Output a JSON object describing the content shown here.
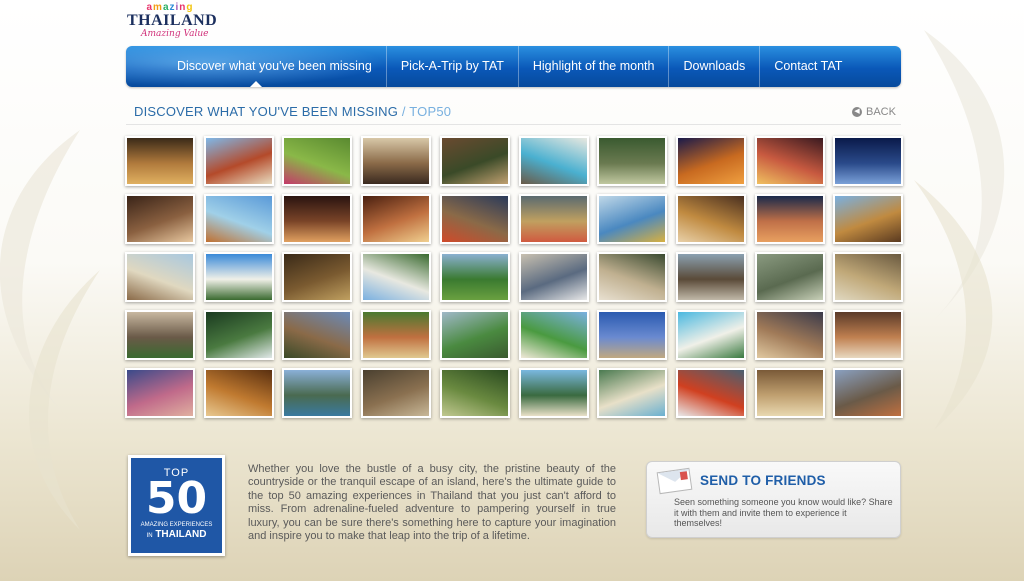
{
  "logo": {
    "word_amazing": "amazing",
    "word_thailand": "THAILAND",
    "tagline": "Amazing Value"
  },
  "nav": {
    "items": [
      {
        "label": "Discover what you've been missing",
        "active": true
      },
      {
        "label": "Pick-A-Trip by TAT",
        "active": false
      },
      {
        "label": "Highlight of the month",
        "active": false
      },
      {
        "label": "Downloads",
        "active": false
      },
      {
        "label": "Contact TAT",
        "active": false
      }
    ]
  },
  "breadcrumb": {
    "main": "DISCOVER WHAT YOU'VE BEEN MISSING",
    "separator": "/",
    "current": "TOP50"
  },
  "back_label": "BACK",
  "gallery": {
    "rows": 5,
    "columns": 10,
    "thumbnails": [
      {
        "subject": "hotel lobby interior",
        "colors": [
          "#3a2a18",
          "#b07a3c",
          "#e0b060"
        ]
      },
      {
        "subject": "thai temple roof",
        "colors": [
          "#7fb8e8",
          "#b44a2a",
          "#e8dcc0"
        ]
      },
      {
        "subject": "tea plantation workers",
        "colors": [
          "#5a8a30",
          "#8ab848",
          "#c43a6a"
        ]
      },
      {
        "subject": "colonial building courtyard",
        "colors": [
          "#d8c8a8",
          "#8a6a48",
          "#3a2a20"
        ]
      },
      {
        "subject": "wooden resort villa",
        "colors": [
          "#6a4a30",
          "#3a4a28",
          "#c0a070"
        ]
      },
      {
        "subject": "pool villa",
        "colors": [
          "#e8e8e0",
          "#4ab0d0",
          "#6a5a48"
        ]
      },
      {
        "subject": "elephant in forest",
        "colors": [
          "#3a5a30",
          "#6a7a50",
          "#c0c8a0"
        ]
      },
      {
        "subject": "temple ruins at dusk",
        "colors": [
          "#1a1a4a",
          "#c86a20",
          "#f0a040"
        ]
      },
      {
        "subject": "night festival lights",
        "colors": [
          "#3a1a20",
          "#c85a40",
          "#f0c060"
        ]
      },
      {
        "subject": "night city skyline",
        "colors": [
          "#0a1a4a",
          "#2a4a8a",
          "#7aa0d8"
        ]
      },
      {
        "subject": "spa room interior",
        "colors": [
          "#3a2418",
          "#8a6040",
          "#e8c8a0"
        ]
      },
      {
        "subject": "resort infinity pool",
        "colors": [
          "#5a9ad8",
          "#a0d0e8",
          "#c07030"
        ]
      },
      {
        "subject": "candlelit dining",
        "colors": [
          "#2a1410",
          "#7a4428",
          "#e0a060"
        ]
      },
      {
        "subject": "grand banquet hall",
        "colors": [
          "#4a2010",
          "#c07040",
          "#f0d090"
        ]
      },
      {
        "subject": "elephant festival",
        "colors": [
          "#2a3a5a",
          "#8a6a48",
          "#d04a2a"
        ]
      },
      {
        "subject": "floating market boats",
        "colors": [
          "#5a6a70",
          "#c0a060",
          "#d05a40"
        ]
      },
      {
        "subject": "traditional performance",
        "colors": [
          "#c0d8e8",
          "#4a88c0",
          "#d8b040"
        ]
      },
      {
        "subject": "market shop shelves",
        "colors": [
          "#4a3020",
          "#c08a40",
          "#e8d0a8"
        ]
      },
      {
        "subject": "palm beach sunset",
        "colors": [
          "#1a2a4a",
          "#c07048",
          "#e8a060"
        ]
      },
      {
        "subject": "golden sanctuary temple",
        "colors": [
          "#7ab0e0",
          "#c08a40",
          "#5a3a20"
        ]
      },
      {
        "subject": "beach swing",
        "colors": [
          "#a8c8e0",
          "#e0d8c0",
          "#8a6a48"
        ]
      },
      {
        "subject": "tropical beach palms",
        "colors": [
          "#3a8ad8",
          "#f0f0e8",
          "#3a6a30"
        ]
      },
      {
        "subject": "palm fruit harvest",
        "colors": [
          "#3a2a18",
          "#7a5a30",
          "#c0a060"
        ]
      },
      {
        "subject": "island resort cottages",
        "colors": [
          "#3a6a30",
          "#e8e8e0",
          "#7ab0e0"
        ]
      },
      {
        "subject": "golf course greens",
        "colors": [
          "#8ab0d0",
          "#3a7a30",
          "#6aa040"
        ]
      },
      {
        "subject": "marina yacht",
        "colors": [
          "#c8c0b0",
          "#5a6a80",
          "#e8e8e8"
        ]
      },
      {
        "subject": "temple with white horse",
        "colors": [
          "#3a4a30",
          "#c0b090",
          "#e8e0d0"
        ]
      },
      {
        "subject": "riverside town",
        "colors": [
          "#8aa0b0",
          "#5a4a38",
          "#c0b8a8"
        ]
      },
      {
        "subject": "misty mountains",
        "colors": [
          "#8a9a80",
          "#5a6a50",
          "#c8d0b8"
        ]
      },
      {
        "subject": "boutique hotel lounge",
        "colors": [
          "#6a5a40",
          "#c0a878",
          "#e0d8c0"
        ]
      },
      {
        "subject": "khmer temple ruins",
        "colors": [
          "#c8b8a0",
          "#6a5a48",
          "#3a6a30"
        ]
      },
      {
        "subject": "jungle waterfall",
        "colors": [
          "#1a3a20",
          "#4a7a40",
          "#e0e8e8"
        ]
      },
      {
        "subject": "ancient stupa",
        "colors": [
          "#6a8ab8",
          "#8a6a48",
          "#3a4a28"
        ]
      },
      {
        "subject": "garden resort",
        "colors": [
          "#4a7a30",
          "#c07040",
          "#e0c890"
        ]
      },
      {
        "subject": "mountain golf course",
        "colors": [
          "#a0b8c8",
          "#4a8a40",
          "#3a5a30"
        ]
      },
      {
        "subject": "golf green sand bunker",
        "colors": [
          "#7ab0e0",
          "#4a9a40",
          "#f0e8d8"
        ]
      },
      {
        "subject": "wooden pier sunset",
        "colors": [
          "#2a5ab0",
          "#6a8ad0",
          "#c0a880"
        ]
      },
      {
        "subject": "turquoise bay",
        "colors": [
          "#4ab8e0",
          "#f0f0e8",
          "#3a7a40"
        ]
      },
      {
        "subject": "lake at dusk",
        "colors": [
          "#3a3a4a",
          "#a07a58",
          "#e0c8a0"
        ]
      },
      {
        "subject": "hillside villa terrace",
        "colors": [
          "#5a3a28",
          "#c08050",
          "#e8d8c0"
        ]
      },
      {
        "subject": "island sunset",
        "colors": [
          "#3a4a8a",
          "#c06a8a",
          "#e0b0a0"
        ]
      },
      {
        "subject": "river cruise boat",
        "colors": [
          "#5a3010",
          "#c07a30",
          "#e8c890"
        ]
      },
      {
        "subject": "limestone islands",
        "colors": [
          "#8ab0d8",
          "#4a6a50",
          "#3a7aa0"
        ]
      },
      {
        "subject": "rock climbing",
        "colors": [
          "#4a4030",
          "#8a7050",
          "#c8b898"
        ]
      },
      {
        "subject": "jungle zipline",
        "colors": [
          "#2a4a20",
          "#6a8a40",
          "#c0c890"
        ]
      },
      {
        "subject": "tropical island",
        "colors": [
          "#7ab8e0",
          "#3a6a40",
          "#e8e0c8"
        ]
      },
      {
        "subject": "secluded beach",
        "colors": [
          "#4a7a50",
          "#e8e0c8",
          "#6ab0d0"
        ]
      },
      {
        "subject": "whitewater rafting",
        "colors": [
          "#4a6070",
          "#d04020",
          "#e8e8e8"
        ]
      },
      {
        "subject": "beach bungalow dining",
        "colors": [
          "#7a5a38",
          "#c0a070",
          "#e8d8b0"
        ]
      },
      {
        "subject": "hill tribe village",
        "colors": [
          "#8aa0c0",
          "#6a5a48",
          "#c07040"
        ]
      }
    ]
  },
  "badge": {
    "top_label": "TOP",
    "number": "50",
    "subtitle": "AMAZING EXPERIENCES",
    "in_label": "IN",
    "country": "THAILAND"
  },
  "intro_text": "Whether you love the bustle of a busy city, the pristine beauty of the countryside or the tranquil escape of an island, here's the ultimate guide to the top 50 amazing experiences in Thailand that you just can't afford to miss. From adrenaline-fueled adventure to pampering yourself in true luxury, you can be sure there's something here to capture your imagination and inspire you to make that leap into the trip of a lifetime.",
  "send_to_friends": {
    "title": "SEND TO FRIENDS",
    "description": "Seen something someone you know would like? Share it with them and invite them to experience it themselves!"
  }
}
